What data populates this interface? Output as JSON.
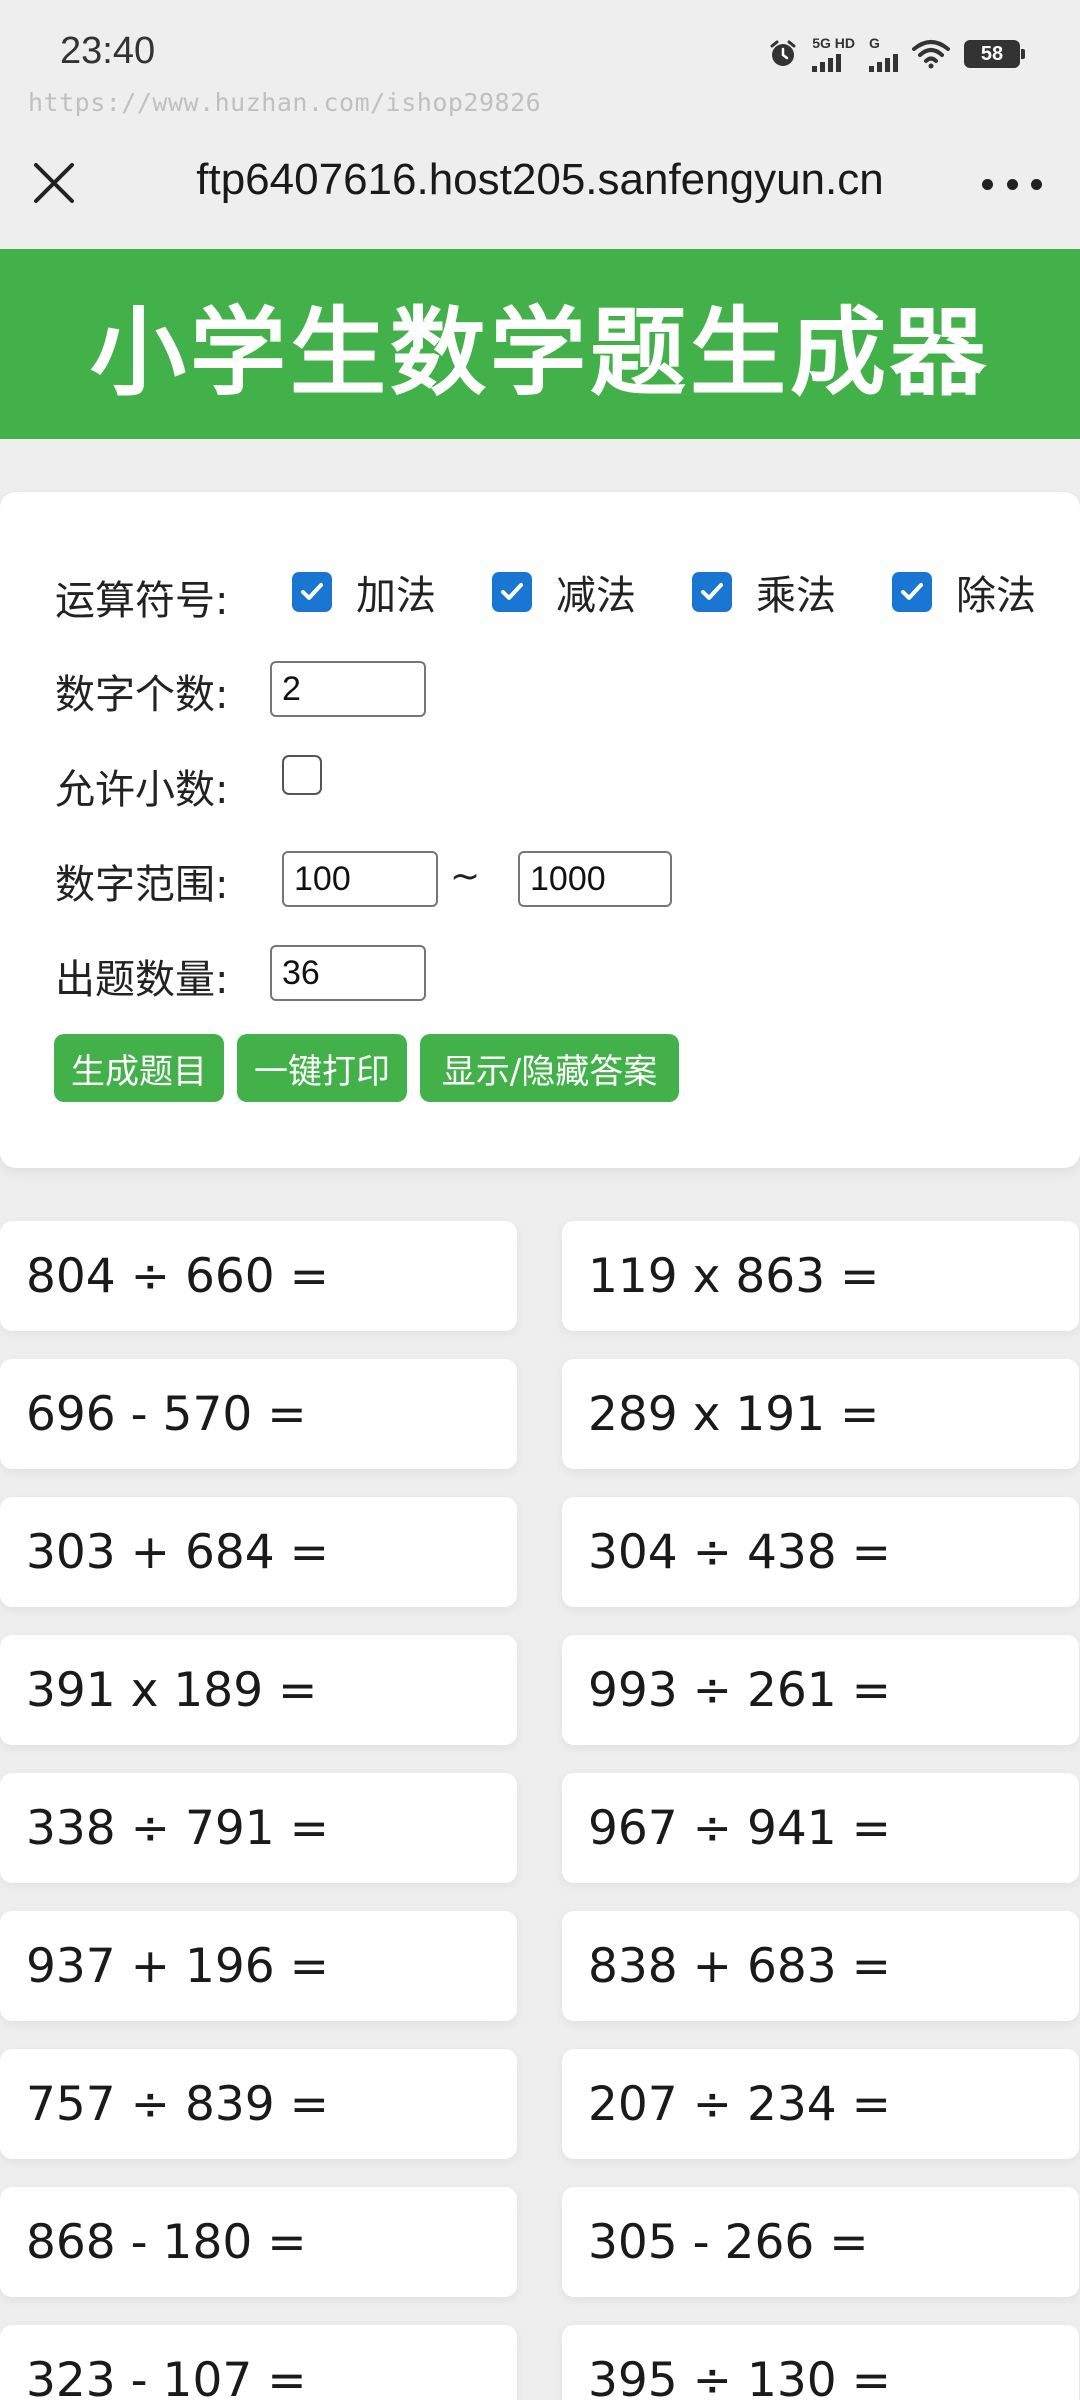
{
  "status_bar": {
    "time": "23:40",
    "network_label_1": "5G HD",
    "network_label_2": "G",
    "battery": "58",
    "icons": [
      "alarm-icon",
      "signal-icon",
      "wifi-icon",
      "battery-icon"
    ]
  },
  "watermark": "https://www.huzhan.com/ishop29826",
  "browser": {
    "url": "ftp6407616.host205.sanfengyun.cn",
    "icons": [
      "close-icon",
      "more-icon"
    ]
  },
  "app": {
    "title": "小学生数学题生成器"
  },
  "controls": {
    "operators_label": "运算符号:",
    "operators": [
      {
        "label": "加法",
        "checked": true
      },
      {
        "label": "减法",
        "checked": true
      },
      {
        "label": "乘法",
        "checked": true
      },
      {
        "label": "除法",
        "checked": true
      }
    ],
    "count_label": "数字个数:",
    "count_value": "2",
    "decimal_label": "允许小数:",
    "decimal_checked": false,
    "range_label": "数字范围:",
    "range_min": "100",
    "range_sep": "~",
    "range_max": "1000",
    "quantity_label": "出题数量:",
    "quantity_value": "36",
    "buttons": {
      "generate": "生成题目",
      "print": "一键打印",
      "toggle_answers": "显示/隐藏答案"
    }
  },
  "problems": [
    "804 ÷ 660 =",
    "119 x 863 =",
    "696 - 570 =",
    "289 x 191 =",
    "303 + 684 =",
    "304 ÷ 438 =",
    "391 x 189 =",
    "993 ÷ 261 =",
    "338 ÷ 791 =",
    "967 ÷ 941 =",
    "937 + 196 =",
    "838 + 683 =",
    "757 ÷ 839 =",
    "207 ÷ 234 =",
    "868 - 180 =",
    "305 - 266 =",
    "323 - 107 =",
    "395 ÷ 130 ="
  ],
  "colors": {
    "brand_green": "#43b14a",
    "checkbox_blue": "#1976d2",
    "background": "#eeeeee"
  }
}
